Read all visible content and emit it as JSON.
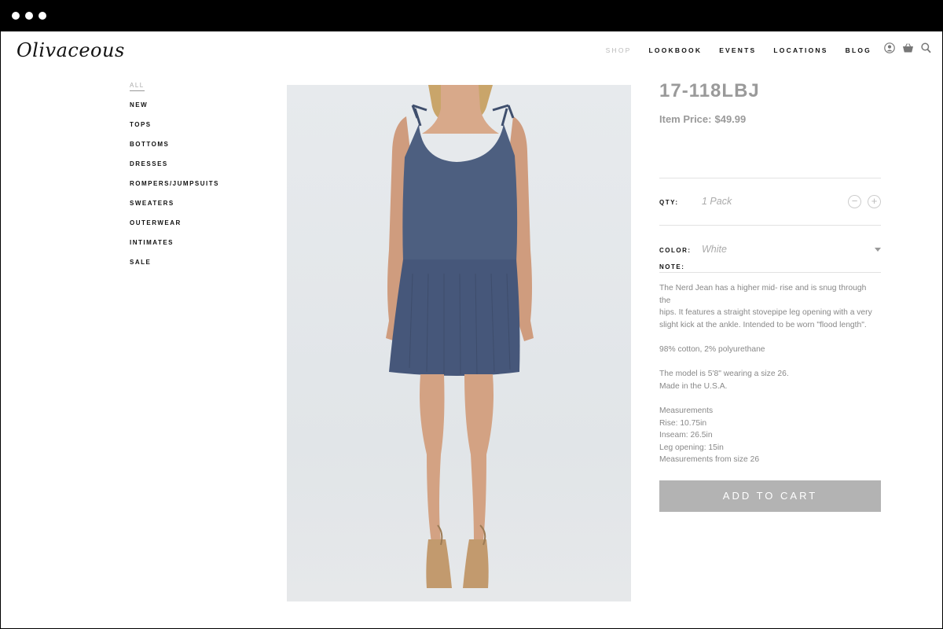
{
  "brand": {
    "logo_text": "Olivaceous"
  },
  "topnav": [
    {
      "label": "SHOP",
      "state": "muted"
    },
    {
      "label": "LOOKBOOK"
    },
    {
      "label": "EVENTS"
    },
    {
      "label": "LOCATIONS"
    },
    {
      "label": "BLOG"
    }
  ],
  "icons": [
    "account-icon",
    "cart-icon",
    "search-icon"
  ],
  "sidenav": [
    {
      "label": "ALL",
      "active": true
    },
    {
      "label": "NEW"
    },
    {
      "label": "TOPS"
    },
    {
      "label": "BOTTOMS"
    },
    {
      "label": "DRESSES"
    },
    {
      "label": "ROMPERS/JUMPSUITS"
    },
    {
      "label": "SWEATERS"
    },
    {
      "label": "OUTERWEAR"
    },
    {
      "label": "INTIMATES"
    },
    {
      "label": "SALE"
    }
  ],
  "product": {
    "sku": "17-118LBJ",
    "price_label": "Item Price:",
    "price": "$49.99",
    "qty_label": "QTY:",
    "qty_value": "1 Pack",
    "color_label": "COLOR:",
    "color_value": "White",
    "note_label": "NOTE:",
    "note_paragraphs": [
      [
        "The Nerd Jean has a higher mid- rise and is snug through the",
        "hips. It features a straight stovepipe leg opening with a very",
        "slight kick at the ankle.  Intended to be worn \"flood length\"."
      ],
      [
        "98% cotton, 2% polyurethane"
      ],
      [
        "The model is 5'8\" wearing a size 26.",
        "Made in the U.S.A."
      ],
      [
        "Measurements",
        "Rise: 10.75in",
        "Inseam: 26.5in",
        "Leg opening: 15in",
        "Measurements from size 26"
      ]
    ],
    "add_to_cart": "ADD TO CART"
  },
  "colors": {
    "accent_gray": "#b3b3b3",
    "dress": "#4b5d7e"
  }
}
